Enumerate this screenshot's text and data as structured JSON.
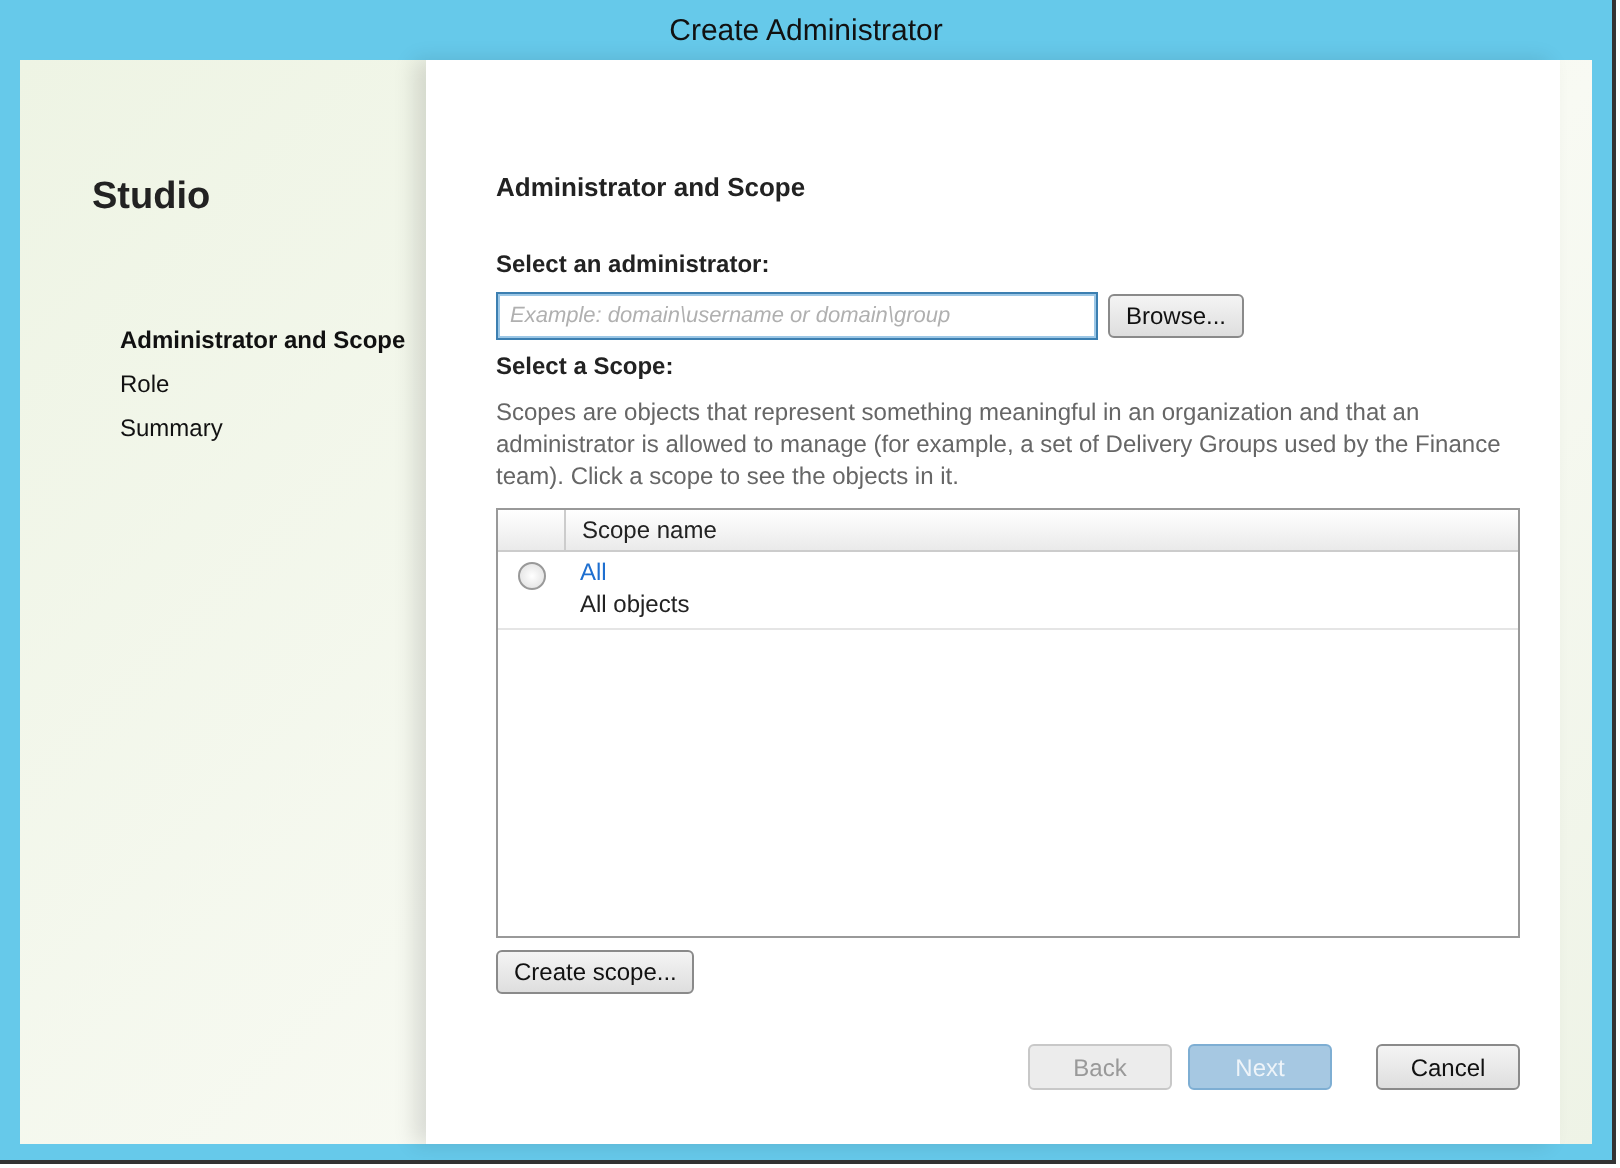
{
  "window": {
    "title": "Create Administrator"
  },
  "sidebar": {
    "title": "Studio",
    "steps": [
      {
        "label": "Administrator and Scope",
        "selected": true
      },
      {
        "label": "Role",
        "selected": false
      },
      {
        "label": "Summary",
        "selected": false
      }
    ]
  },
  "page": {
    "heading": "Administrator and Scope",
    "administrator": {
      "label": "Select an administrator:",
      "placeholder": "Example: domain\\username or domain\\group",
      "browse_button": "Browse..."
    },
    "scope": {
      "label": "Select a Scope:",
      "description": "Scopes are objects that represent something meaningful in an organization and that an administrator is allowed to manage (for example, a set of Delivery Groups used by the Finance team). Click a scope to see the objects in it.",
      "table": {
        "columns": [
          "Scope name"
        ],
        "rows": [
          {
            "name": "All",
            "description": "All objects",
            "selected": false
          }
        ]
      },
      "create_button": "Create scope..."
    }
  },
  "buttons": [
    {
      "label": "Back",
      "disabled": true,
      "default": false
    },
    {
      "label": "Next",
      "disabled": true,
      "default": true
    },
    {
      "label": "Cancel",
      "disabled": false,
      "default": false
    }
  ]
}
